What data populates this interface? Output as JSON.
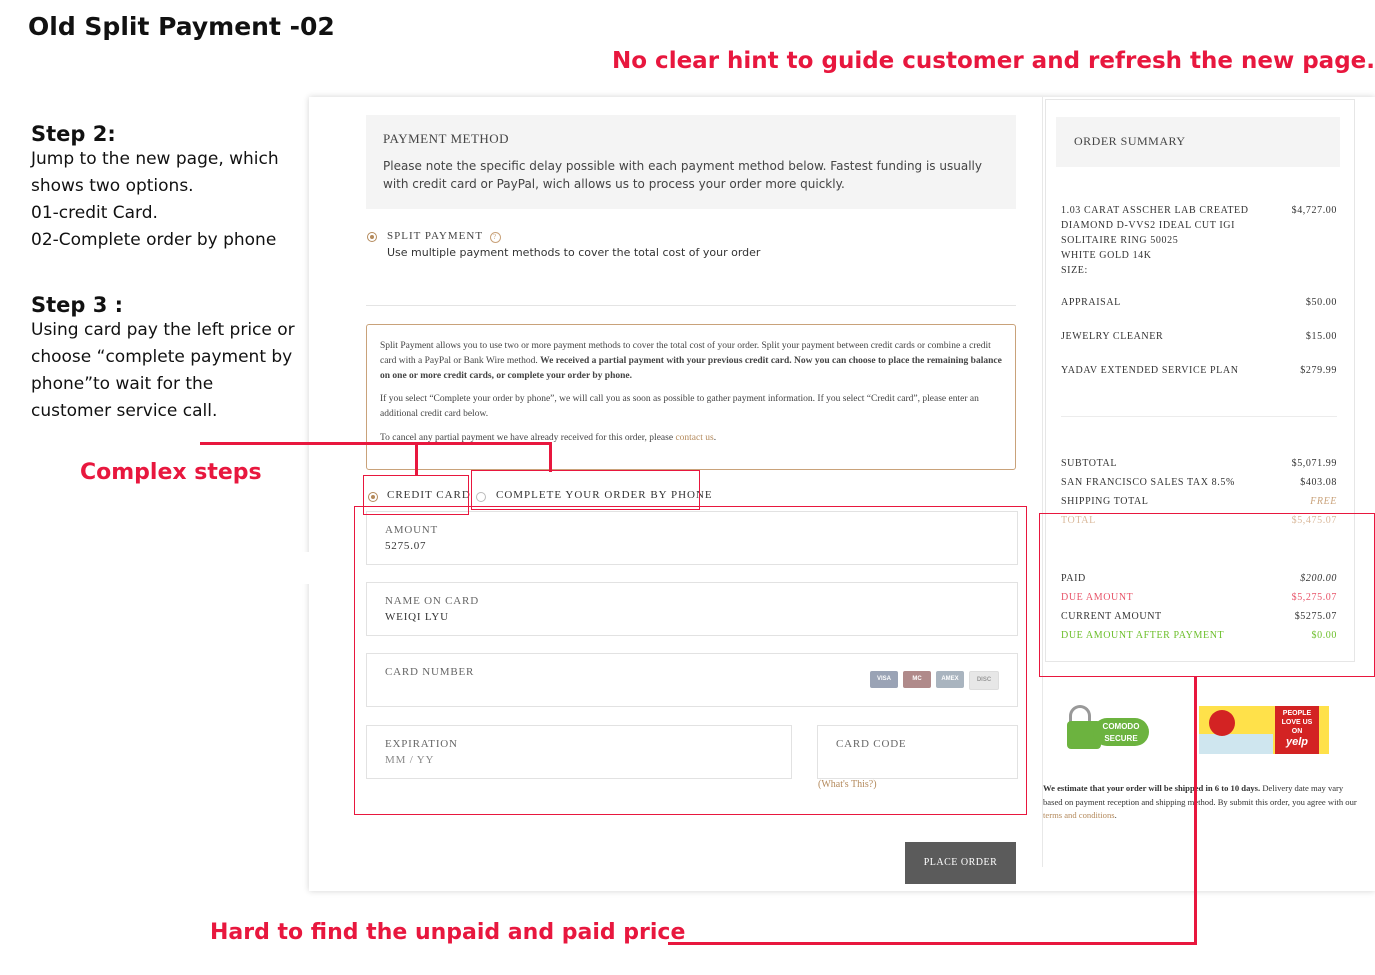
{
  "annotations": {
    "doc_title": "Old Split Payment -02",
    "top_hint": "No clear hint to guide customer and refresh the new page.",
    "step2_title": "Step 2:",
    "step2_lines": [
      "Jump to the new page, which",
      "shows two options.",
      "01-credit Card.",
      "02-Complete order by phone"
    ],
    "step3_title": "Step 3 :",
    "step3_lines": [
      "Using card pay the left price or",
      "choose “complete payment by",
      "phone”to wait for the",
      "customer service call."
    ],
    "complex_steps": "Complex steps",
    "hard_to_find": "Hard to find the unpaid and paid price",
    "accent_color": "#e8173e"
  },
  "payment_method": {
    "heading": "PAYMENT METHOD",
    "note": "Please note the specific delay possible with each payment method below. Fastest funding is usually with credit card or PayPal, wich allows us to process your order more quickly."
  },
  "split_payment": {
    "title": "SPLIT PAYMENT",
    "help_icon": "question-circle-icon",
    "description": "Use multiple payment methods to cover the total cost of your order"
  },
  "info_box": {
    "para1_normal": "Split Payment allows you to use two or more payment methods to cover the total cost of your order. Split your payment between credit cards or combine a credit card with a PayPal or Bank Wire method. ",
    "para1_bold": "We received a partial payment with your previous credit card. Now you can choose to place the remaining balance on one or more credit cards, or complete your order by phone.",
    "para2": "If you select “Complete your order by phone”, we will call you as soon as possible to gather payment information. If you select “Credit card”, please enter an additional credit card below.",
    "para3_text": "To cancel any partial payment we have already received for this order, please ",
    "para3_link": "contact us",
    "para3_end": ".",
    "border_color": "#c9a27a",
    "link_color": "#b48a5c"
  },
  "options": {
    "credit_card": "CREDIT CARD",
    "by_phone": "COMPLETE YOUR ORDER BY PHONE"
  },
  "form": {
    "amount_label": "AMOUNT",
    "amount_value": "5275.07",
    "name_label": "NAME ON CARD",
    "name_value": "WEIQI LYU",
    "card_number_label": "CARD NUMBER",
    "card_icons": [
      "VISA",
      "MC",
      "AMEX",
      "DISC"
    ],
    "expiration_label": "EXPIRATION",
    "expiration_placeholder": "MM / YY",
    "card_code_label": "CARD CODE",
    "whats_this": "(What's This?)",
    "place_order": "PLACE ORDER"
  },
  "order_summary": {
    "heading": "ORDER SUMMARY",
    "product_lines": [
      "1.03 CARAT ASSCHER LAB CREATED",
      "DIAMOND D-VVS2 IDEAL CUT IGI",
      "SOLITAIRE RING 50025",
      "WHITE GOLD 14K",
      "SIZE:"
    ],
    "product_price": "$4,727.00",
    "items": [
      {
        "label": "APPRAISAL",
        "price": "$50.00"
      },
      {
        "label": "JEWELRY CLEANER",
        "price": "$15.00"
      },
      {
        "label": "YADAV EXTENDED SERVICE PLAN",
        "price": "$279.99"
      }
    ],
    "subtotal_label": "SUBTOTAL",
    "subtotal": "$5,071.99",
    "tax_label": "SAN FRANCISCO SALES TAX 8.5%",
    "tax": "$403.08",
    "shipping_label": "SHIPPING TOTAL",
    "shipping": "FREE",
    "total_label": "TOTAL",
    "total": "$5,475.07",
    "paid_label": "PAID",
    "paid": "$200.00",
    "due_label": "DUE AMOUNT",
    "due": "$5,275.07",
    "current_label": "CURRENT AMOUNT",
    "current": "$5275.07",
    "after_label": "DUE AMOUNT AFTER PAYMENT",
    "after": "$0.00",
    "colors": {
      "due": "#e8556a",
      "after": "#6cbf2a",
      "shipping": "#c9a27a",
      "total": "#d9b89a"
    }
  },
  "badges": {
    "comodo_line1": "COMODO",
    "comodo_line2": "SECURE",
    "yelp_line1": "PEOPLE",
    "yelp_line2": "LOVE US",
    "yelp_line3": "ON",
    "yelp_logo": "yelp"
  },
  "delivery": {
    "text_start": "We estimate that your order will be shipped in 6 to 10 days.",
    "text_rest": " Delivery date may vary based on payment reception and shipping method. By submit this order, you agree with our ",
    "link": "terms and conditions",
    "text_end": "."
  }
}
